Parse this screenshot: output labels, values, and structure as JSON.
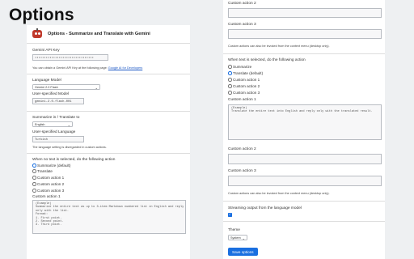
{
  "page": {
    "heading": "Options"
  },
  "left": {
    "title": "Options - Summarize and Translate with Gemini",
    "api_key": {
      "label": "Gemini API Key",
      "value": "••••••••••••••••••••••••••••••••",
      "help": "You can obtain a Gemini API Key at the following page:",
      "link": "Google AI for Developers"
    },
    "language_model": {
      "label": "Language Model",
      "value": "Gemini 2.0 Flash"
    },
    "user_model": {
      "label": "User-specified Model",
      "value": "gemini-2.0-flash-001"
    },
    "summarize_lang": {
      "label": "Summarize in / Translate to",
      "value": "English"
    },
    "user_lang": {
      "label": "User-specified Language",
      "value": "Turkish",
      "help": "The language setting is disregarded in custom actions."
    },
    "no_text": {
      "label": "When no text is selected, do the following action",
      "options": [
        "Summarize (default)",
        "Translate",
        "Custom action 1",
        "Custom action 2",
        "Custom action 3"
      ]
    },
    "custom1": {
      "label": "Custom action 1",
      "text": "(Example)\nSummarize the entire text as up to 3-item Markdown numbered list in English and reply\nonly with the list.\nFormat:\n1. First point.\n2. Second point.\n3. Third point."
    }
  },
  "right": {
    "custom2_top": {
      "label": "Custom action 2"
    },
    "custom3_top": {
      "label": "Custom action 3",
      "help": "Custom actions can also be invoked from the context menu (desktop only)."
    },
    "text_selected": {
      "label": "When text is selected, do the following action",
      "options": [
        "Summarize",
        "Translate (default)",
        "Custom action 1",
        "Custom action 2",
        "Custom action 3"
      ]
    },
    "custom1": {
      "label": "Custom action 1",
      "text": "(Example)\nTranslate the entire text into English and reply only with the translated result."
    },
    "custom2": {
      "label": "Custom action 2"
    },
    "custom3": {
      "label": "Custom action 3",
      "help": "Custom actions can also be invoked from the context menu (desktop only)."
    },
    "streaming": {
      "label": "Streaming output from the language model"
    },
    "theme": {
      "label": "Theme",
      "value": "System"
    },
    "save_label": "Save options"
  }
}
